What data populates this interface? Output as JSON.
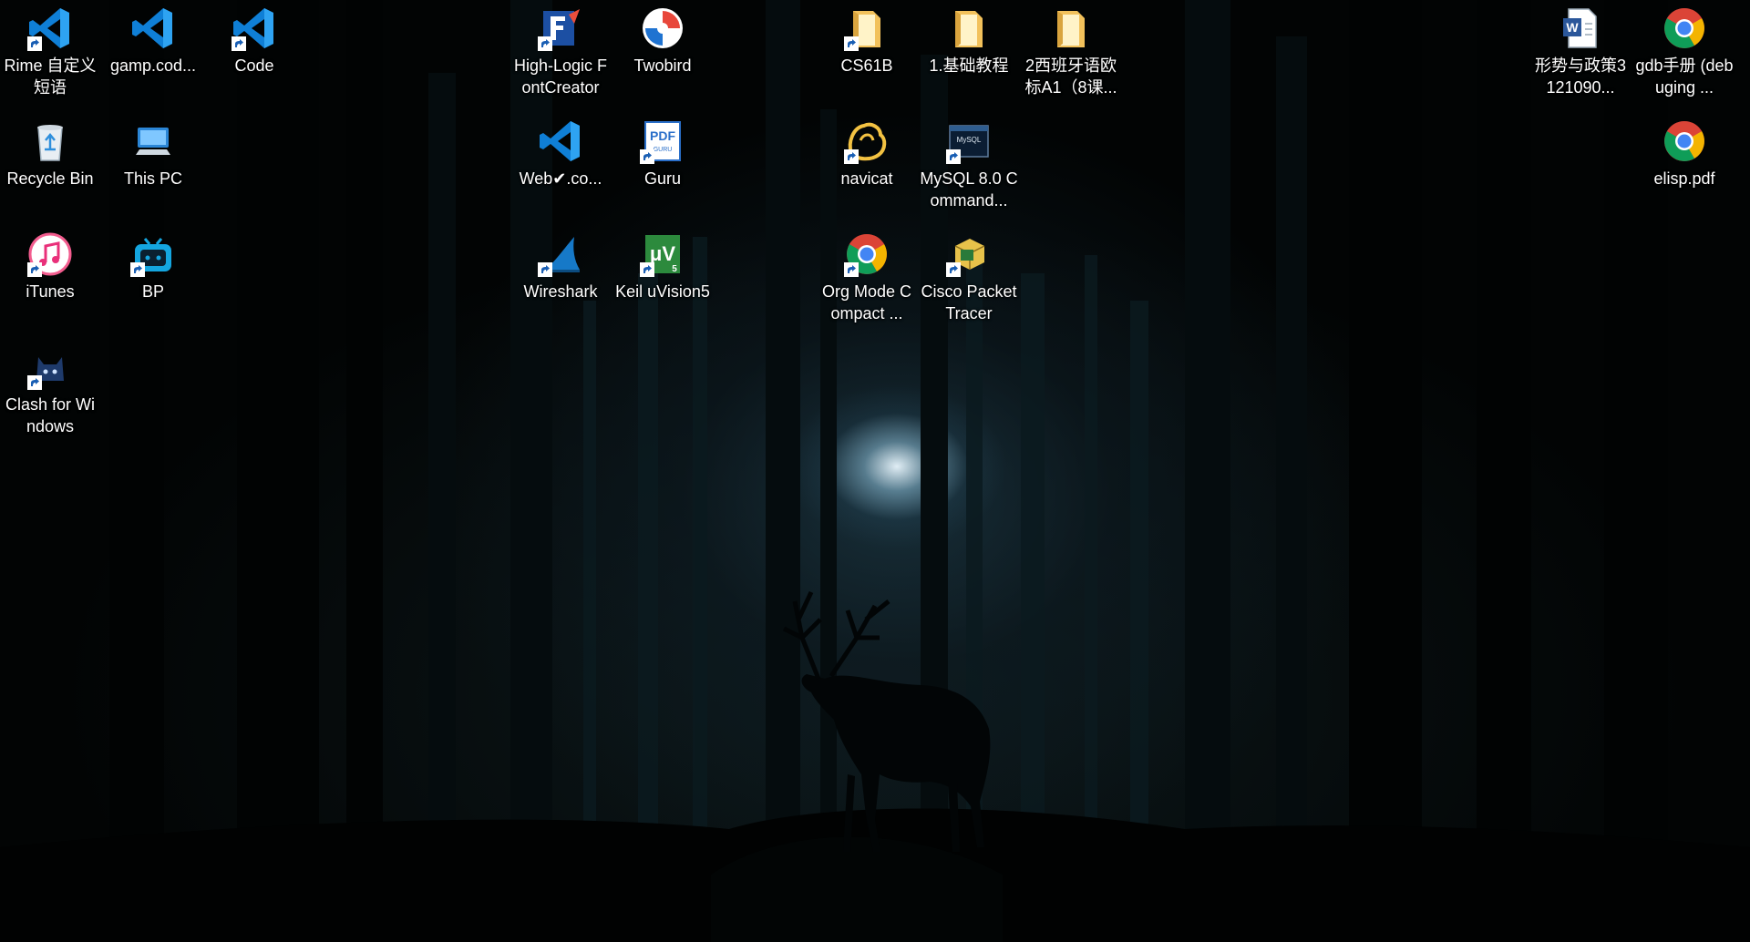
{
  "desktop": {
    "icons": [
      {
        "id": "rime",
        "label": "Rime 自定义短语",
        "icon": "vscode-icon",
        "shortcut": true
      },
      {
        "id": "gamp",
        "label": "gamp.cod...",
        "icon": "vscode-icon",
        "shortcut": false
      },
      {
        "id": "code",
        "label": "Code",
        "icon": "vscode-icon",
        "shortcut": true
      },
      {
        "id": "highlogic",
        "label": "High-Logic FontCreator",
        "icon": "fontcreator-icon",
        "shortcut": true
      },
      {
        "id": "twobird",
        "label": "Twobird",
        "icon": "twobird-icon",
        "shortcut": false
      },
      {
        "id": "cs61b",
        "label": "CS61B",
        "icon": "folder-icon",
        "shortcut": true
      },
      {
        "id": "basic",
        "label": "1.基础教程",
        "icon": "folder-icon",
        "shortcut": false
      },
      {
        "id": "spanish",
        "label": "2西班牙语欧标A1（8课...",
        "icon": "folder-icon",
        "shortcut": false
      },
      {
        "id": "xingshi",
        "label": "形势与政策3121090...",
        "icon": "word-doc-icon",
        "shortcut": false
      },
      {
        "id": "gdb",
        "label": "gdb手册 (debuging ...",
        "icon": "chrome-icon",
        "shortcut": false
      },
      {
        "id": "recycle",
        "label": "Recycle Bin",
        "icon": "recycle-bin-icon",
        "shortcut": false
      },
      {
        "id": "thispc",
        "label": "This PC",
        "icon": "this-pc-icon",
        "shortcut": false
      },
      {
        "id": "webco",
        "label": "Web✔.co...",
        "icon": "vscode-icon",
        "shortcut": false
      },
      {
        "id": "guru",
        "label": "Guru",
        "icon": "pdf-guru-icon",
        "shortcut": true
      },
      {
        "id": "navicat",
        "label": "navicat",
        "icon": "navicat-icon",
        "shortcut": true
      },
      {
        "id": "mysql",
        "label": "MySQL 8.0 Command...",
        "icon": "mysql-icon",
        "shortcut": true
      },
      {
        "id": "elisp",
        "label": "elisp.pdf",
        "icon": "chrome-icon",
        "shortcut": false
      },
      {
        "id": "itunes",
        "label": "iTunes",
        "icon": "itunes-icon",
        "shortcut": true
      },
      {
        "id": "bp",
        "label": "BP",
        "icon": "bilibili-icon",
        "shortcut": true
      },
      {
        "id": "wireshark",
        "label": "Wireshark",
        "icon": "wireshark-icon",
        "shortcut": true
      },
      {
        "id": "keil",
        "label": "Keil uVision5",
        "icon": "keil-icon",
        "shortcut": true
      },
      {
        "id": "orgmode",
        "label": "Org Mode Compact ...",
        "icon": "chrome-icon",
        "shortcut": true
      },
      {
        "id": "cisco",
        "label": "Cisco Packet Tracer",
        "icon": "cisco-packet-tracer-icon",
        "shortcut": true
      },
      {
        "id": "clash",
        "label": "Clash for Windows",
        "icon": "clash-cat-icon",
        "shortcut": true
      }
    ]
  },
  "colors": {
    "vscode_blue": "#0f7fd6",
    "folder_yellow": "#f2c15b",
    "chrome_red": "#db4437",
    "chrome_yellow": "#f4b400",
    "chrome_green": "#0f9d58",
    "chrome_blue": "#4285f4",
    "label_text": "#ffffff"
  }
}
